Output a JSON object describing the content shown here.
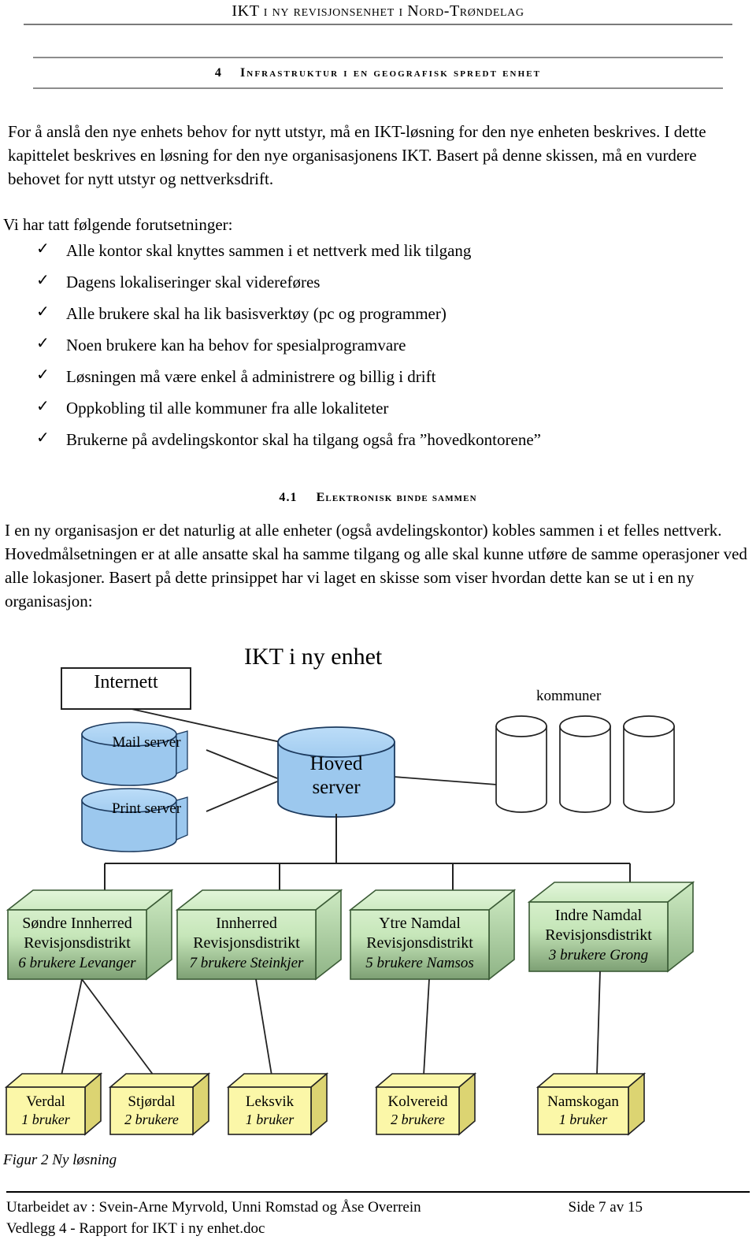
{
  "header": {
    "running_head": "IKT i ny revisjonsenhet i Nord-Trøndelag"
  },
  "chapter": {
    "number": "4",
    "title": "Infrastruktur i en geografisk spredt enhet"
  },
  "intro_paragraph": "For å anslå den nye enhets behov for nytt utstyr, må en IKT-løsning for den nye enheten beskrives. I dette kapittelet beskrives en løsning for den nye organisasjonens IKT. Basert på denne skissen, må en vurdere behovet for nytt utstyr og nettverksdrift.",
  "assumptions": {
    "lead": "Vi har tatt følgende forutsetninger:",
    "check_glyph": "✓",
    "items": [
      "Alle kontor skal knyttes sammen i et nettverk med lik tilgang",
      "Dagens lokaliseringer skal videreføres",
      "Alle brukere skal ha lik basisverktøy (pc og programmer)",
      "Noen brukere kan ha behov for spesialprogramvare",
      "Løsningen må være enkel å administrere og billig i drift",
      "Oppkobling til alle kommuner fra alle lokaliteter",
      "Brukerne på avdelingskontor skal ha tilgang også fra ”hovedkontorene”"
    ]
  },
  "subsection": {
    "number": "4.1",
    "title": "Elektronisk binde sammen",
    "paragraph": "I en ny organisasjon er det naturlig at alle enheter (også avdelingskontor) kobles sammen i et felles nettverk. Hovedmålsetningen er at alle ansatte skal ha samme tilgang og alle skal kunne utføre de samme operasjoner ved alle lokasjoner. Basert på dette prinsippet har vi laget en skisse som viser hvordan dette kan se ut i en ny organisasjon:"
  },
  "figure": {
    "title": "IKT i ny enhet",
    "caption": "Figur 2 Ny løsning",
    "internett_label": "Internett",
    "kommuner_label": "kommuner",
    "colors": {
      "cylinder_fill": "#9CC8EE",
      "cylinder_top": "#B0D4F4",
      "district_top": "#D6F0CC",
      "district_front_top": "#CDEAC2",
      "district_front_bottom": "#7FA176",
      "district_side": "#9CC092",
      "municipality_fill": "#FBF7A8",
      "municipality_side": "#DCD472",
      "line": "#222222"
    },
    "servers": [
      {
        "name": "Mail server"
      },
      {
        "name": "Print server"
      }
    ],
    "main_server": {
      "line1": "Hoved",
      "line2": "server"
    },
    "kommuner_count": 3,
    "districts": [
      {
        "line1": "Søndre Innherred",
        "line2": "Revisjonsdistrikt",
        "line3": "6 brukere Levanger"
      },
      {
        "line1": "Innherred",
        "line2": "Revisjonsdistrikt",
        "line3": "7 brukere Steinkjer"
      },
      {
        "line1": "Ytre Namdal",
        "line2": "Revisjonsdistrikt",
        "line3": "5 brukere Namsos"
      },
      {
        "line1": "Indre Namdal",
        "line2": "Revisjonsdistrikt",
        "line3": "3 brukere Grong"
      }
    ],
    "offices": [
      {
        "name": "Verdal",
        "users": "1 bruker"
      },
      {
        "name": "Stjørdal",
        "users": "2 brukere"
      },
      {
        "name": "Leksvik",
        "users": "1 bruker"
      },
      {
        "name": "Kolvereid",
        "users": "2 brukere"
      },
      {
        "name": "Namskogan",
        "users": "1 bruker"
      }
    ]
  },
  "footer": {
    "line1": "Utarbeidet av : Svein-Arne Myrvold, Unni Romstad og Åse Overrein",
    "line2": "Vedlegg 4 - Rapport for IKT i ny enhet.doc",
    "page": "Side 7 av 15"
  }
}
